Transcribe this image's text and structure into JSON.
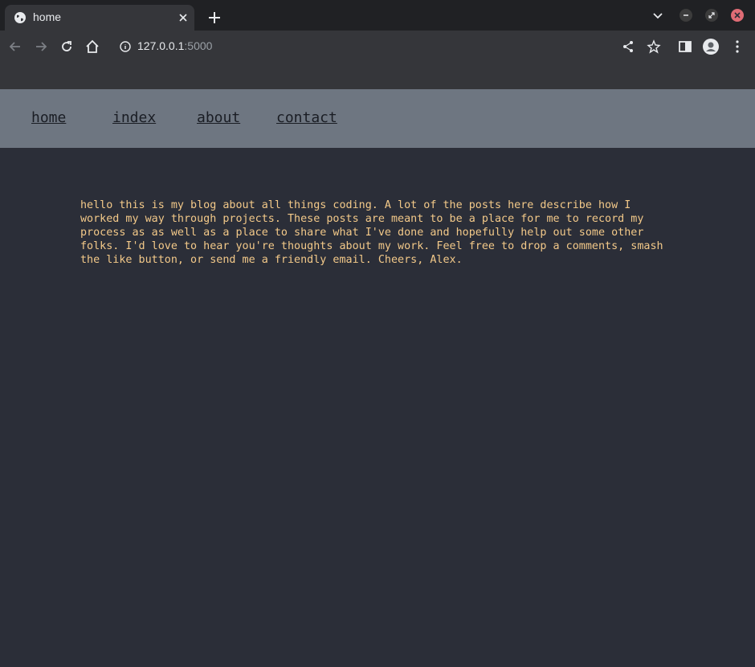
{
  "browser": {
    "tab_title": "home",
    "address_host": "127.0.0.1",
    "address_port": ":5000"
  },
  "nav": {
    "items": [
      {
        "label": "home"
      },
      {
        "label": "index"
      },
      {
        "label": "about"
      },
      {
        "label": "contact"
      }
    ]
  },
  "main": {
    "intro": "hello this is my blog about all things coding. A lot of the posts here describe how I worked my way through projects. These posts are meant to be a place for me to record my process as as well as a place to share what I've done and hopefully help out some other folks. I'd love to hear you're thoughts about my work. Feel free to drop a comments, smash the like button, or send me a friendly email. Cheers, Alex."
  },
  "colors": {
    "page_background": "#2b2e38",
    "navbar_background": "#6e7681",
    "text_accent": "#f3c989",
    "nav_link": "#1a1d24"
  }
}
